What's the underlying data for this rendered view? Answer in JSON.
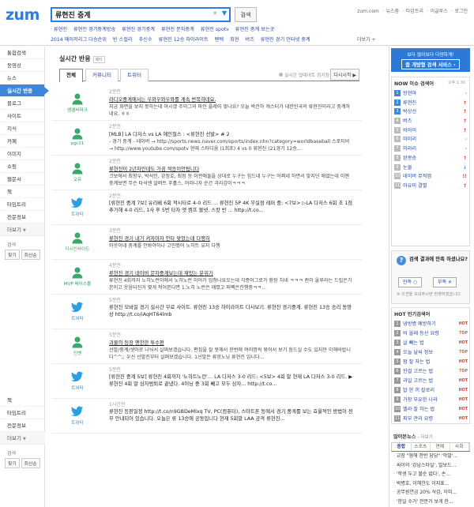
{
  "header": {
    "logo": "zum",
    "search_value": "류현진 중계",
    "search_button": "검색",
    "top_links": [
      "zum.com",
      "· 뉴스줌",
      "· 타임트리",
      "· 이글루스",
      "· 로그인"
    ],
    "related_row1": [
      "· 류현진",
      "류현진 경기중계방송",
      "류현진 경기중계",
      "류현진 문자중계",
      "류현진 spotv",
      "류현진 중계 보는곳"
    ],
    "related_row2": [
      "2014 메이저리그 다승순위",
      "빈 스컬리",
      "추신수",
      "류현진 12승 하이라이트",
      "펜텍",
      "최현",
      "버즈",
      "류현진 경기 인터넷 중계"
    ],
    "more_related": "더보기 +"
  },
  "left_nav": {
    "items": [
      "통합검색",
      "동영상",
      "뉴스",
      "실시간 반응",
      "블로그",
      "사이트",
      "지식",
      "카페",
      "이미지",
      "쇼핑",
      "웹문서",
      "책",
      "타임트리",
      "전문정보"
    ],
    "more": "더보기",
    "option_label": "검색",
    "option_btns": [
      "찾기",
      "최신순"
    ],
    "items2": [
      "책",
      "타임트리",
      "전문정보"
    ],
    "more2": "더보기",
    "option_label2": "검색",
    "option_btns2": [
      "찾기",
      "최신순"
    ]
  },
  "main": {
    "title": "실시간 반응",
    "badge": "베타",
    "tabs": [
      "전체",
      "커뮤니티",
      "트위터"
    ],
    "status": "실시간 업데이트 정지됨",
    "refresh": "다시시작 ▶",
    "posts": [
      {
        "src": "엠엘비파크",
        "time": "2분전",
        "title": "라디오중계에서는 우와우와우와를 계속 반복하네요.",
        "body": "지금 화면을 보지 못하는데 아시겠 주이그의 파인 플레이 맞나요? 오늘 박건하 캐스터가 대한민국의 류현진이라고 중계하네요. ㅎㅎ",
        "tw": false,
        "ul": true
      },
      {
        "src": "pgr21",
        "time": "2분전",
        "title": "[MLB] LA 다저스 vs LA 에인절스 : <류현진 선발> # 2",
        "body": "- 경기 중계 - 네이버 → http://sports.news.naver.com/sports/index.nhn?category=worldbaseball 스포티비 → http://www.youtube.com/spotv 현재 스타디움 (1회초) 4 vs 0 류현진 (21경기 12승...",
        "tw": false,
        "ul": false
      },
      {
        "src": "오유",
        "time": "2분전",
        "title": "류현진이 2년차인데도 가끔 적응이안됩니다",
        "body": "크보에서 최향우, 박석민, 강정호, 최정 등 이런애들을 상대로 누구는 힘드네 누구는 어쩌네 하면서 맞지던 애였는데 이젠 중계보면 무슨 타석엔 알버트 푸홀스, 어러니자 순간 괴리감이ㅋㅋㅋ",
        "tw": false,
        "ul": true
      },
      {
        "src": "트위터",
        "time": "2분전",
        "title": "[류현진 중계 7보] 유리베 6회 적시타로 4-0 리드 ... 류현진 5P 4K 무실점 레퍼 중: <7보> ▷LA 다저스 6회 초 1점 추가해 4-0 리드, 1사 후 5번 타자 엣 캠프 볼넷, 스캇 반 ...  http://t.co...",
        "body": "",
        "tw": true,
        "ul": false
      },
      {
        "src": "디시인사이드",
        "time": "3분전",
        "title": "류현진 경기 내가 켜자마자 안타 맞았는데 다행히",
        "body": "아웃이네 중계를 안봐야하나 고민했어 노히트 유지 다행",
        "tw": false,
        "ul": true
      },
      {
        "src": "MVP 베이스볼",
        "time": "4분전",
        "title": "류현진 경기 네이버 문자중계보는데 재밌는 분위기",
        "body": "류현진 4회까지 노히노런이에서 노히노런 이어가 엄청나요오는데 각종어그로가 환장 치네 ㅋㅋㅋ 퀸이 울루라는 드립은기본이고 웃음터진거 몇게 적어본다면 1.노히 노런은 깨졌고 퍼펙은진행중ㅋㅋ...",
        "tw": false,
        "ul": true
      },
      {
        "src": "트위터",
        "time": "5분전",
        "title": "류현진 모바일 경기 실시간 무료 사이트. 류현진 13승 하이라이트 다시보기. 류현진 경기중계. 류현진 13승 승리 동영상 http://t.co/iAqHT64lmb",
        "body": "",
        "tw": true,
        "ul": false
      },
      {
        "src": "인벤",
        "time": "5분전",
        "title": "괴물의 등장 엔한한 투수편",
        "body": "선발/중계/셋아로 나눠서 살펴보겠습니다. 편집을 잘 못해서 한번에 여러명씩 묶어서 보기 힘드실 수도 있지만 이해바랍니다^^;; 우선 선발진부터 살펴보겠습니다. 1선발은 류망노닝 류현진 입니다...",
        "tw": false,
        "ul": true
      },
      {
        "src": "트위터",
        "time": "5분전",
        "title": "[류현진 중계 5보] 류현진 4회까지 '노히트노런'… LA 다저스 3-0 리드: <5보> 4회 말 현재 LA 다저스 3-0 리드. ▶류현진 4회 말 삼자범퇴로 끝냈다. 4이닝 중 3회 빼고 모두 삼자... http://t.co...",
        "body": "",
        "tw": true,
        "ul": false
      },
      {
        "src": "트위터",
        "time": "1시간전",
        "title": "류현진 등판일정 http://t.co/n9GBDeMlxq TV, PC(컴퓨터), 스마트폰 등에서 경기 중계를 보는 효율적인 방법이 전부 안내되어 있습니다. 오늘은 류 13승에 공동입니다 현재 5회말 LAA 공격 류현진...",
        "body": "",
        "tw": true,
        "ul": false
      }
    ]
  },
  "right": {
    "promo_top": "보다 많이보다 다양하게!",
    "promo_main": "줌 개방형 검색 서비스 ›",
    "rank_title": "NOW 이슈 검색어",
    "rank_time": "오후 1:30",
    "ranks": [
      {
        "n": "1",
        "t": "장현아",
        "m": "-",
        "c": "dash"
      },
      {
        "n": "2",
        "t": "류현진",
        "m": "↑",
        "c": "red"
      },
      {
        "n": "3",
        "t": "박상선",
        "m": "↑",
        "c": "red"
      },
      {
        "n": "4",
        "t": "버즈",
        "m": "↑",
        "c": "red"
      },
      {
        "n": "5",
        "t": "비아이",
        "m": "↑",
        "c": "red"
      },
      {
        "n": "6",
        "t": "미미리",
        "m": "-",
        "c": "dash"
      },
      {
        "n": "7",
        "t": "미라리",
        "m": "-",
        "c": "dash"
      },
      {
        "n": "8",
        "t": "완봉승",
        "m": "↑",
        "c": "red"
      },
      {
        "n": "9",
        "t": "눈물",
        "m": "↓",
        "c": "blue"
      },
      {
        "n": "10",
        "t": "네이버 뮤직앱",
        "m": "!!",
        "c": "red"
      },
      {
        "n": "11",
        "t": "아유미 결별",
        "m": "↑",
        "c": "red"
      }
    ],
    "survey_q": "검색 결과에 만족 하셨나요?",
    "survey_yes": "만족 ○",
    "survey_no": "부족 ✕",
    "survey_note": "※ 의견을 보내주시면 반영하겠습니다.",
    "hot_title": "HOT 인기검색어",
    "hots": [
      {
        "n": "1",
        "t": "냉방병 예방하기",
        "b": "HOT",
        "c": "hot"
      },
      {
        "n": "2",
        "t": "비 올때 등산 요령",
        "b": "TOP",
        "c": "top"
      },
      {
        "n": "3",
        "t": "살 빼는 법",
        "b": "HOT",
        "c": "hot"
      },
      {
        "n": "4",
        "t": "오늘 날씨 정보",
        "b": "TOP",
        "c": "top"
      },
      {
        "n": "5",
        "t": "잠 잘 자는 법",
        "b": "HOT",
        "c": "hot"
      },
      {
        "n": "6",
        "t": "잔걸 고르는 법",
        "b": "TOP",
        "c": "top"
      },
      {
        "n": "7",
        "t": "과일 고르는 법",
        "b": "HOT",
        "c": "hot"
      },
      {
        "n": "8",
        "t": "밥 한 끼 칼로리",
        "b": "HOT",
        "c": "hot"
      },
      {
        "n": "9",
        "t": "가장 부유한 나라",
        "b": "HOT",
        "c": "hot"
      },
      {
        "n": "10",
        "t": "멜라 잘 하는 법",
        "b": "HOT",
        "c": "hot"
      },
      {
        "n": "11",
        "t": "피부 관리 요령",
        "b": "HOT",
        "c": "hot"
      }
    ],
    "news_title": "많이본뉴스",
    "news_sub": "› 더보기",
    "news_tabs": [
      "종합",
      "스포츠",
      "연예",
      "사회"
    ],
    "news": [
      "교장 \"혐해 한반 담당\" '막말'...",
      "싸이의 '강남스타일', 빌보드...",
      "'학생 두고 볼순 없다', 손...",
      "박병호, 이해찬도 이지표...",
      "공무원연금 20% 삭감, 이미...",
      "'한일 수가' 전문가 보게 한...",
      "포천사건 피의자 '남편 자다...",
      "박선영 \"송중국 처음본 날 ..."
    ]
  }
}
